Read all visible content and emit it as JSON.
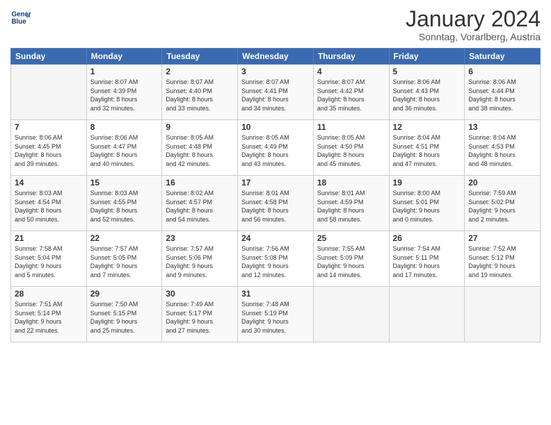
{
  "header": {
    "logo_line1": "General",
    "logo_line2": "Blue",
    "month": "January 2024",
    "location": "Sonntag, Vorarlberg, Austria"
  },
  "days_of_week": [
    "Sunday",
    "Monday",
    "Tuesday",
    "Wednesday",
    "Thursday",
    "Friday",
    "Saturday"
  ],
  "weeks": [
    [
      {
        "day": "",
        "info": ""
      },
      {
        "day": "1",
        "info": "Sunrise: 8:07 AM\nSunset: 4:39 PM\nDaylight: 8 hours\nand 32 minutes."
      },
      {
        "day": "2",
        "info": "Sunrise: 8:07 AM\nSunset: 4:40 PM\nDaylight: 8 hours\nand 33 minutes."
      },
      {
        "day": "3",
        "info": "Sunrise: 8:07 AM\nSunset: 4:41 PM\nDaylight: 8 hours\nand 34 minutes."
      },
      {
        "day": "4",
        "info": "Sunrise: 8:07 AM\nSunset: 4:42 PM\nDaylight: 8 hours\nand 35 minutes."
      },
      {
        "day": "5",
        "info": "Sunrise: 8:06 AM\nSunset: 4:43 PM\nDaylight: 8 hours\nand 36 minutes."
      },
      {
        "day": "6",
        "info": "Sunrise: 8:06 AM\nSunset: 4:44 PM\nDaylight: 8 hours\nand 38 minutes."
      }
    ],
    [
      {
        "day": "7",
        "info": "Sunrise: 8:06 AM\nSunset: 4:45 PM\nDaylight: 8 hours\nand 39 minutes."
      },
      {
        "day": "8",
        "info": "Sunrise: 8:06 AM\nSunset: 4:47 PM\nDaylight: 8 hours\nand 40 minutes."
      },
      {
        "day": "9",
        "info": "Sunrise: 8:05 AM\nSunset: 4:48 PM\nDaylight: 8 hours\nand 42 minutes."
      },
      {
        "day": "10",
        "info": "Sunrise: 8:05 AM\nSunset: 4:49 PM\nDaylight: 8 hours\nand 43 minutes."
      },
      {
        "day": "11",
        "info": "Sunrise: 8:05 AM\nSunset: 4:50 PM\nDaylight: 8 hours\nand 45 minutes."
      },
      {
        "day": "12",
        "info": "Sunrise: 8:04 AM\nSunset: 4:51 PM\nDaylight: 8 hours\nand 47 minutes."
      },
      {
        "day": "13",
        "info": "Sunrise: 8:04 AM\nSunset: 4:53 PM\nDaylight: 8 hours\nand 48 minutes."
      }
    ],
    [
      {
        "day": "14",
        "info": "Sunrise: 8:03 AM\nSunset: 4:54 PM\nDaylight: 8 hours\nand 50 minutes."
      },
      {
        "day": "15",
        "info": "Sunrise: 8:03 AM\nSunset: 4:55 PM\nDaylight: 8 hours\nand 52 minutes."
      },
      {
        "day": "16",
        "info": "Sunrise: 8:02 AM\nSunset: 4:57 PM\nDaylight: 8 hours\nand 54 minutes."
      },
      {
        "day": "17",
        "info": "Sunrise: 8:01 AM\nSunset: 4:58 PM\nDaylight: 8 hours\nand 56 minutes."
      },
      {
        "day": "18",
        "info": "Sunrise: 8:01 AM\nSunset: 4:59 PM\nDaylight: 8 hours\nand 58 minutes."
      },
      {
        "day": "19",
        "info": "Sunrise: 8:00 AM\nSunset: 5:01 PM\nDaylight: 9 hours\nand 0 minutes."
      },
      {
        "day": "20",
        "info": "Sunrise: 7:59 AM\nSunset: 5:02 PM\nDaylight: 9 hours\nand 2 minutes."
      }
    ],
    [
      {
        "day": "21",
        "info": "Sunrise: 7:58 AM\nSunset: 5:04 PM\nDaylight: 9 hours\nand 5 minutes."
      },
      {
        "day": "22",
        "info": "Sunrise: 7:57 AM\nSunset: 5:05 PM\nDaylight: 9 hours\nand 7 minutes."
      },
      {
        "day": "23",
        "info": "Sunrise: 7:57 AM\nSunset: 5:06 PM\nDaylight: 9 hours\nand 9 minutes."
      },
      {
        "day": "24",
        "info": "Sunrise: 7:56 AM\nSunset: 5:08 PM\nDaylight: 9 hours\nand 12 minutes."
      },
      {
        "day": "25",
        "info": "Sunrise: 7:55 AM\nSunset: 5:09 PM\nDaylight: 9 hours\nand 14 minutes."
      },
      {
        "day": "26",
        "info": "Sunrise: 7:54 AM\nSunset: 5:11 PM\nDaylight: 9 hours\nand 17 minutes."
      },
      {
        "day": "27",
        "info": "Sunrise: 7:52 AM\nSunset: 5:12 PM\nDaylight: 9 hours\nand 19 minutes."
      }
    ],
    [
      {
        "day": "28",
        "info": "Sunrise: 7:51 AM\nSunset: 5:14 PM\nDaylight: 9 hours\nand 22 minutes."
      },
      {
        "day": "29",
        "info": "Sunrise: 7:50 AM\nSunset: 5:15 PM\nDaylight: 9 hours\nand 25 minutes."
      },
      {
        "day": "30",
        "info": "Sunrise: 7:49 AM\nSunset: 5:17 PM\nDaylight: 9 hours\nand 27 minutes."
      },
      {
        "day": "31",
        "info": "Sunrise: 7:48 AM\nSunset: 5:19 PM\nDaylight: 9 hours\nand 30 minutes."
      },
      {
        "day": "",
        "info": ""
      },
      {
        "day": "",
        "info": ""
      },
      {
        "day": "",
        "info": ""
      }
    ]
  ]
}
